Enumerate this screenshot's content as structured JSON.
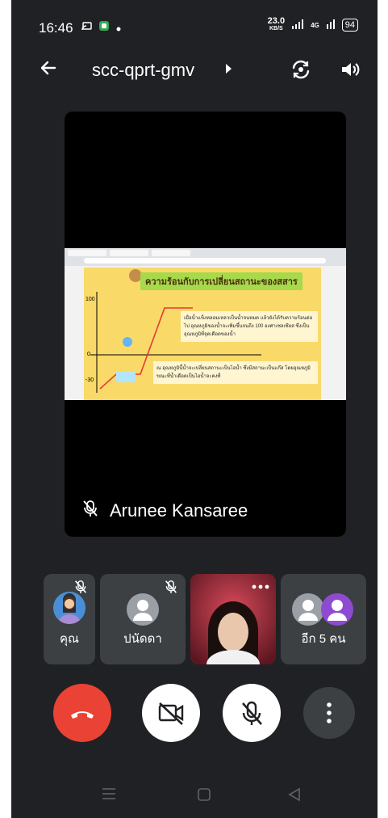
{
  "status_bar": {
    "time": "16:46",
    "data_speed": "23.0",
    "data_unit": "KB/S",
    "network": "4G",
    "battery": "94"
  },
  "header": {
    "meeting_code": "scc-qprt-gmv"
  },
  "main_tile": {
    "participant_name": "Arunee Kansaree",
    "slide": {
      "title": "ความร้อนกับการเปลี่ยนสถานะของสสาร",
      "text1": "เมื่อน้ำแข็งหลอมเหลวเป็นน้ำจนหมด แล้วยังได้รับความร้อนต่อไป อุณหภูมิของน้ำจะเพิ่มขึ้นจนถึง 100 องศาเซลเซียส ซึ่งเป็นอุณหภูมิที่จุดเดือดของน้ำ",
      "text2": "ณ อุณหภูมินี้น้ำจะเปลี่ยนสถานะเป็นไอน้ำ ซึ่งมีสถานะเป็นแก๊ส โดยอุณหภูมิขณะที่น้ำเดือดเป็นไอน้ำจะคงที่",
      "y_labels": [
        "100",
        "0",
        "-30"
      ]
    }
  },
  "tiles": [
    {
      "label": "คุณ"
    },
    {
      "label": "ปนัดดา"
    },
    {
      "label": ""
    },
    {
      "label": "อีก 5 คน"
    }
  ],
  "colors": {
    "background": "#202124",
    "tile": "#3c4043",
    "end_call": "#ea4335",
    "control_light": "#ffffff",
    "control_dark": "#3c4043"
  }
}
